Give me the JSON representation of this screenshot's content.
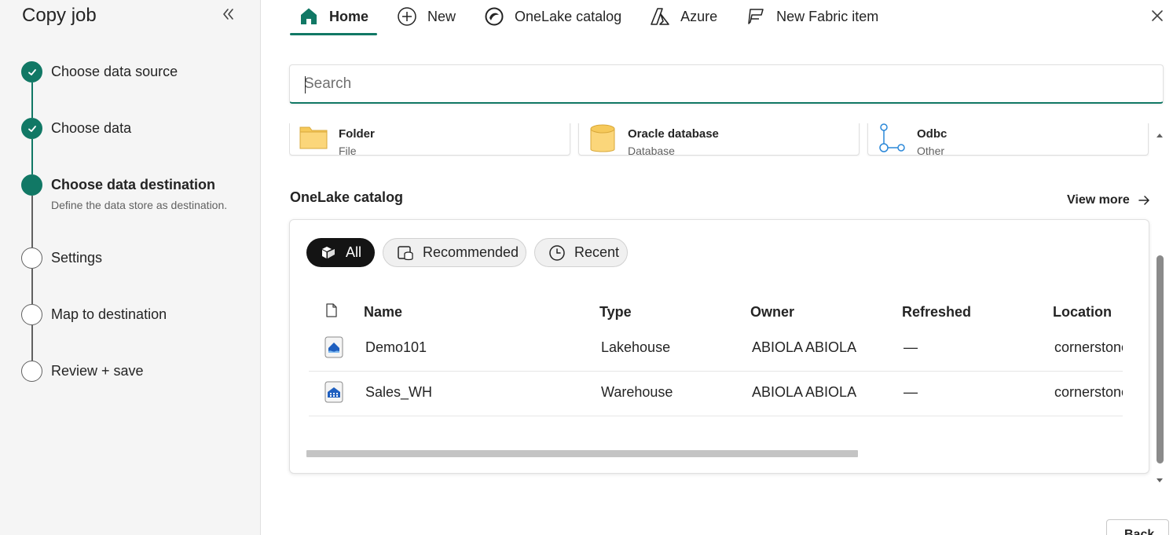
{
  "sidebar": {
    "title": "Copy job",
    "steps": [
      {
        "label": "Choose data source",
        "state": "done"
      },
      {
        "label": "Choose data",
        "state": "done"
      },
      {
        "label": "Choose data destination",
        "state": "current",
        "sub": "Define the data store as destination."
      },
      {
        "label": "Settings",
        "state": "pending"
      },
      {
        "label": "Map to destination",
        "state": "pending"
      },
      {
        "label": "Review + save",
        "state": "pending"
      }
    ]
  },
  "nav": {
    "items": [
      {
        "label": "Home",
        "icon": "home-icon"
      },
      {
        "label": "New",
        "icon": "add-circle-icon"
      },
      {
        "label": "OneLake catalog",
        "icon": "onelake-icon"
      },
      {
        "label": "Azure",
        "icon": "azure-icon"
      },
      {
        "label": "New Fabric item",
        "icon": "fabric-icon"
      }
    ]
  },
  "search": {
    "placeholder": "Search"
  },
  "sources": [
    {
      "name": "Folder",
      "type": "File",
      "icon": "folder-icon"
    },
    {
      "name": "Oracle database",
      "type": "Database",
      "icon": "database-icon"
    },
    {
      "name": "Odbc",
      "type": "Other",
      "icon": "odbc-icon"
    }
  ],
  "onelake": {
    "title": "OneLake catalog",
    "view_more": "View more",
    "filters": [
      "All",
      "Recommended",
      "Recent"
    ],
    "columns": [
      "Name",
      "Type",
      "Owner",
      "Refreshed",
      "Location"
    ],
    "rows": [
      {
        "name": "Demo101",
        "type": "Lakehouse",
        "owner": "ABIOLA ABIOLA",
        "refreshed": "—",
        "location": "cornerstone",
        "icon": "lakehouse-icon"
      },
      {
        "name": "Sales_WH",
        "type": "Warehouse",
        "owner": "ABIOLA ABIOLA",
        "refreshed": "—",
        "location": "cornerstone",
        "icon": "warehouse-icon"
      }
    ]
  },
  "footer": {
    "back_label": "Back"
  },
  "colors": {
    "accent": "#117865",
    "pill_active": "#141414",
    "folder": "#f6c95a"
  }
}
